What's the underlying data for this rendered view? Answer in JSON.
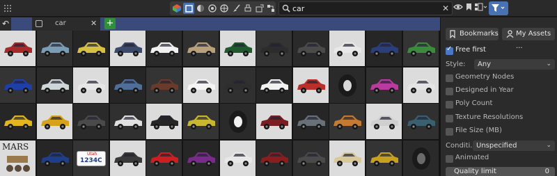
{
  "search": {
    "query": "car"
  },
  "tab": {
    "label": "car"
  },
  "panel": {
    "bookmarks_label": "Bookmarks",
    "my_assets_label": "My Assets ...",
    "free_first": {
      "label": "Free first",
      "checked": true
    },
    "style": {
      "label": "Style:",
      "value": "Any"
    },
    "filters": [
      {
        "label": "Geometry Nodes",
        "checked": false
      },
      {
        "label": "Designed in Year",
        "checked": false
      },
      {
        "label": "Poly Count",
        "checked": false
      },
      {
        "label": "Texture Resolutions",
        "checked": false
      },
      {
        "label": "File Size (MB)",
        "checked": false
      }
    ],
    "condition": {
      "label": "Conditi...",
      "value": "Unspecified"
    },
    "animated": {
      "label": "Animated",
      "checked": false
    },
    "quality_limit": {
      "label": "Quality limit",
      "value": "0"
    }
  },
  "thumbnails": {
    "columns": 12,
    "rows": 4,
    "asset_text": {
      "mars": "MARS",
      "plate_state": "Utah",
      "plate_number": "1234C"
    },
    "colors": [
      [
        "#a52a2a",
        "#7a9db5",
        "#d6c044",
        "#3b4a6b",
        "#f0f0f0",
        "#b7a07a",
        "#1f5a2e",
        "#2c2c2c",
        "#4a4a4a",
        "#e8e8e8",
        "#2a3f7a",
        "#3c8a3c"
      ],
      [
        "#1e3fa8",
        "#cfd6d8",
        "#e6e6e6",
        "#4f6f9a",
        "#6a3a2a",
        "#f4f4f4",
        "#2e2e2e",
        "#f2f2f2",
        "#b9302a",
        "#d8d8d8",
        "#bb3aa0",
        "#e4e4e4"
      ],
      [
        "#e2b51f",
        "#d6a21a",
        "#4a4a4a",
        "#e0e0e0",
        "#262626",
        "#c8b830",
        "#f0f0f0",
        "#7a1e22",
        "#6a7078",
        "#c47a30",
        "#cfcfcf",
        "#3a6070"
      ],
      [
        "#e8e8e8",
        "#1e3e8a",
        "#f4f4f4",
        "#3a3a3a",
        "#cc2020",
        "#7a2a8a",
        "#e8e8e8",
        "#8a1e1e",
        "#4a4a4a",
        "#d8c89a",
        "#c8a020",
        "#6a6a6a"
      ]
    ]
  }
}
